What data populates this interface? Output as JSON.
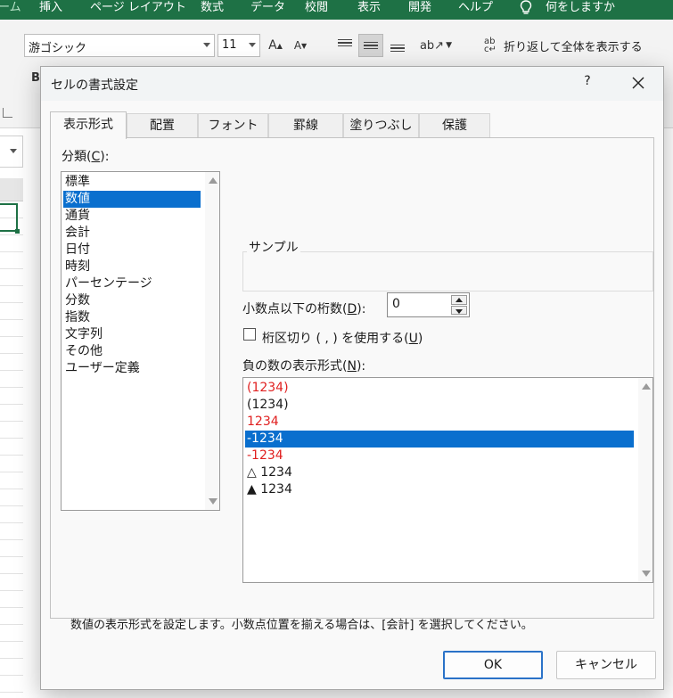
{
  "ribbon": {
    "tabs": [
      "ーム",
      "挿入",
      "ページ レイアウト",
      "数式",
      "データ",
      "校閲",
      "表示",
      "開発",
      "ヘルプ"
    ],
    "tell_me": "何をしますか",
    "font_name": "游ゴシック",
    "font_size": "11",
    "increase_font_label": "A",
    "decrease_font_label": "A",
    "wrap_text_label": "折り返して全体を表示する",
    "bold_label": "B",
    "accent_color": "#1e7145"
  },
  "dialog": {
    "title": "セルの書式設定",
    "help_label": "?",
    "tabs": [
      "表示形式",
      "配置",
      "フォント",
      "罫線",
      "塗りつぶし",
      "保護"
    ],
    "category_label": "分類(",
    "category_key": "C",
    "category_label_end": "):",
    "categories": [
      "標準",
      "数値",
      "通貨",
      "会計",
      "日付",
      "時刻",
      "パーセンテージ",
      "分数",
      "指数",
      "文字列",
      "その他",
      "ユーザー定義"
    ],
    "selected_category": "数値",
    "sample_label": "サンプル",
    "decimal_label": "小数点以下の桁数(",
    "decimal_key": "D",
    "decimal_label_end": "):",
    "decimal_value": "0",
    "separator_label": "桁区切り ( , ) を使用する(",
    "separator_key": "U",
    "separator_label_end": ")",
    "separator_checked": false,
    "negative_label": "負の数の表示形式(",
    "negative_key": "N",
    "negative_label_end": "):",
    "negative_formats": [
      {
        "text": "(1234)",
        "color": "#e02020"
      },
      {
        "text": "(1234)",
        "color": "#1a1a1a"
      },
      {
        "text": "1234",
        "color": "#e02020"
      },
      {
        "text": "-1234",
        "color": "#ffffff"
      },
      {
        "text": "-1234",
        "color": "#e02020"
      },
      {
        "text": "△ 1234",
        "color": "#1a1a1a"
      },
      {
        "text": "▲ 1234",
        "color": "#1a1a1a"
      }
    ],
    "selected_negative": "-1234",
    "description": "数値の表示形式を設定します。小数点位置を揃える場合は、[会計] を選択してください。",
    "ok_label": "OK",
    "cancel_label": "キャンセル",
    "selection_color": "#0a6fce"
  }
}
